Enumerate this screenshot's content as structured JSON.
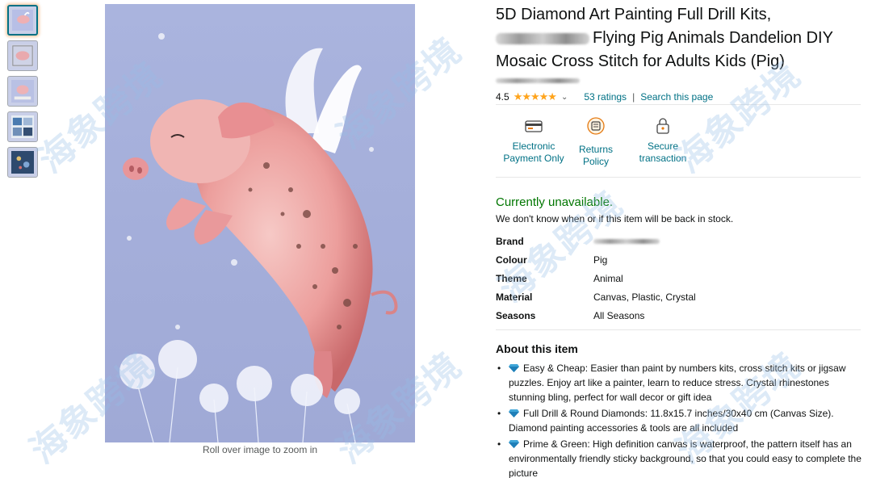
{
  "thumbnails": [
    {
      "name": "thumb-1",
      "selected": true
    },
    {
      "name": "thumb-2",
      "selected": false
    },
    {
      "name": "thumb-3",
      "selected": false
    },
    {
      "name": "thumb-4",
      "selected": false
    },
    {
      "name": "thumb-5",
      "selected": false
    }
  ],
  "main_image": {
    "zoom_hint": "Roll over image to zoom in"
  },
  "product": {
    "title_line1": "5D Diamond Art Painting Full Drill Kits,",
    "title_line2": "Flying Pig Animals Dandelion DIY",
    "title_line3": "Mosaic Cross Stitch for Adults Kids (Pig)"
  },
  "rating": {
    "value": "4.5",
    "stars": "★★★★★",
    "count_label": "53 ratings",
    "separator": "|",
    "search_label": "Search this page"
  },
  "badges": [
    {
      "label_line1": "Electronic",
      "label_line2": "Payment Only",
      "icon": "card-payment-icon"
    },
    {
      "label_line1": "Returns Policy",
      "label_line2": "",
      "icon": "returns-icon"
    },
    {
      "label_line1": "Secure",
      "label_line2": "transaction",
      "icon": "lock-icon"
    }
  ],
  "availability": {
    "status": "Currently unavailable.",
    "note": "We don't know when or if this item will be back in stock."
  },
  "specs": [
    {
      "key": "Brand",
      "value": ""
    },
    {
      "key": "Colour",
      "value": "Pig"
    },
    {
      "key": "Theme",
      "value": "Animal"
    },
    {
      "key": "Material",
      "value": "Canvas, Plastic, Crystal"
    },
    {
      "key": "Seasons",
      "value": "All Seasons"
    }
  ],
  "about": {
    "heading": "About this item",
    "bullets": [
      "Easy & Cheap: Easier than paint by numbers kits, cross stitch kits or jigsaw puzzles. Enjoy art like a painter, learn to reduce stress. Crystal rhinestones stunning bling, perfect for wall decor or gift idea",
      "Full Drill & Round Diamonds: 11.8x15.7 inches/30x40 cm (Canvas Size). Diamond painting accessories & tools are all included",
      "Prime & Green: High definition canvas is waterproof, the pattern itself has an environmentally friendly sticky background, so that you could easy to complete the picture"
    ]
  },
  "watermark": "海象跨境",
  "colors": {
    "link": "#007185",
    "available": "#007600",
    "star": "#ffa41c",
    "canvas_bg": "#a8b2de"
  }
}
